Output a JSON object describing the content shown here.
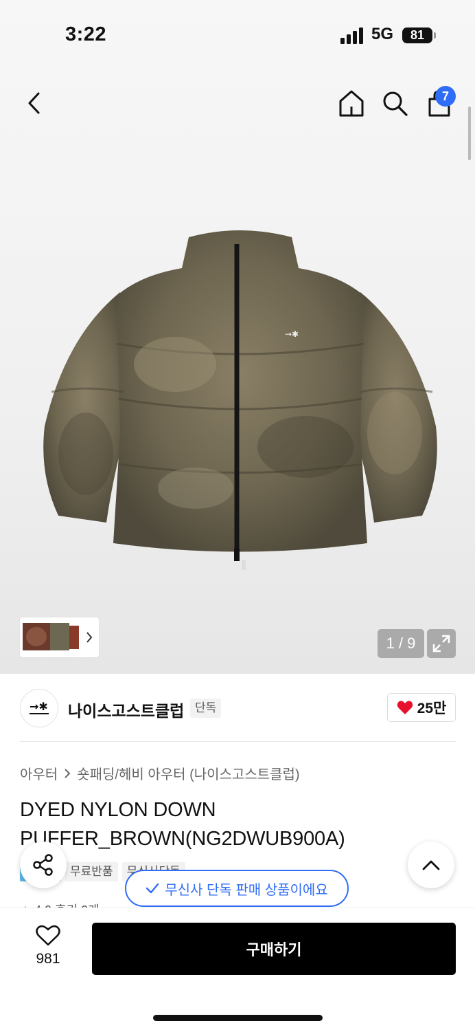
{
  "status_bar": {
    "time": "3:22",
    "network": "5G",
    "battery": "81"
  },
  "cart": {
    "count": "7"
  },
  "gallery": {
    "counter": "1 / 9"
  },
  "brand": {
    "name": "나이스고스트클럽",
    "tag": "단독",
    "likes": "25만"
  },
  "breadcrumb": {
    "category": "아우터",
    "subcategory": "숏패딩/헤비 아우터 (나이스고스트클럽)"
  },
  "product": {
    "title": "DYED NYLON DOWN PUFFER_BROWN(NG2DWUB900A)"
  },
  "tags": [
    "무료반품",
    "무신사단독"
  ],
  "rating": {
    "text": "4.9  후기 9개"
  },
  "toast": {
    "text": "무신사 단독 판매 상품이에요"
  },
  "bottom": {
    "wish_count": "981",
    "buy_label": "구매하기"
  },
  "colors": {
    "accent": "#2f6df6",
    "like": "#e8112d",
    "buy_bg": "#000000"
  }
}
